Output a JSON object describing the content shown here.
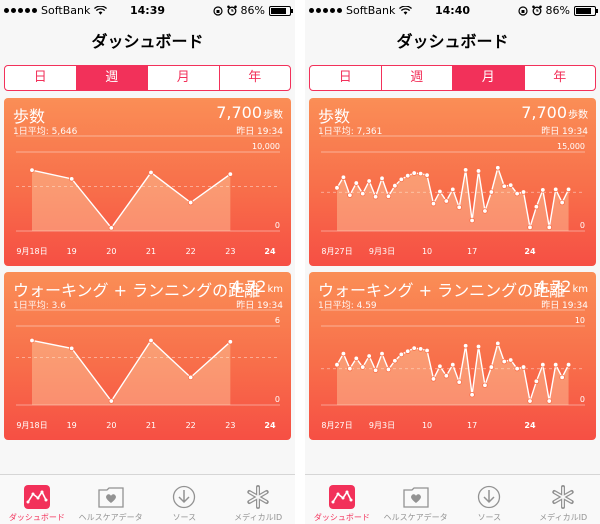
{
  "colors": {
    "accent": "#f2315a",
    "card_top": "#fa8e56",
    "card_bottom": "#f64f44",
    "tab_inactive": "#929292"
  },
  "icons": {
    "dashboard": "dashboard-chart-icon",
    "health_data": "heart-folder-icon",
    "sources": "download-arrow-icon",
    "medical_id": "medical-asterisk-icon"
  },
  "screens": [
    {
      "status": {
        "carrier": "SoftBank",
        "time": "14:39",
        "battery": "86%",
        "battery_level": 0.86
      },
      "title": "ダッシュボード",
      "segments": [
        {
          "label": "日",
          "active": false
        },
        {
          "label": "週",
          "active": true
        },
        {
          "label": "月",
          "active": false
        },
        {
          "label": "年",
          "active": false
        }
      ],
      "cards": [
        {
          "title": "歩数",
          "avg": "1日平均: 5,646",
          "value": "7,700",
          "unit": "歩数",
          "time": "昨日 19:34"
        },
        {
          "title": "ウォーキング + ランニングの距離",
          "avg": "1日平均: 3.6",
          "value": "4.72",
          "unit": "km",
          "time": "昨日 19:34"
        }
      ],
      "tabs": [
        {
          "label": "ダッシュボード",
          "active": true
        },
        {
          "label": "ヘルスケアデータ",
          "active": false
        },
        {
          "label": "ソース",
          "active": false
        },
        {
          "label": "メディカルID",
          "active": false
        }
      ]
    },
    {
      "status": {
        "carrier": "SoftBank",
        "time": "14:40",
        "battery": "86%",
        "battery_level": 0.86
      },
      "title": "ダッシュボード",
      "segments": [
        {
          "label": "日",
          "active": false
        },
        {
          "label": "週",
          "active": false
        },
        {
          "label": "月",
          "active": true
        },
        {
          "label": "年",
          "active": false
        }
      ],
      "cards": [
        {
          "title": "歩数",
          "avg": "1日平均: 7,361",
          "value": "7,700",
          "unit": "歩数",
          "time": "昨日 19:34"
        },
        {
          "title": "ウォーキング + ランニングの距離",
          "avg": "1日平均: 4.59",
          "value": "4.72",
          "unit": "km",
          "time": "昨日 19:34"
        }
      ],
      "tabs": [
        {
          "label": "ダッシュボード",
          "active": true
        },
        {
          "label": "ヘルスケアデータ",
          "active": false
        },
        {
          "label": "ソース",
          "active": false
        },
        {
          "label": "メディカルID",
          "active": false
        }
      ]
    }
  ],
  "chart_data": [
    {
      "type": "line",
      "screen": 0,
      "card": 0,
      "x_labels": [
        "9月18日",
        "19",
        "20",
        "21",
        "22",
        "23",
        "24"
      ],
      "y": [
        7700,
        6600,
        400,
        7400,
        3600,
        7200
      ],
      "ylim": [
        0,
        10000
      ],
      "y_tick_labels": [
        "10,000",
        "0"
      ],
      "avg": 5646
    },
    {
      "type": "line",
      "screen": 0,
      "card": 1,
      "x_labels": [
        "9月18日",
        "19",
        "20",
        "21",
        "22",
        "23",
        "24"
      ],
      "y": [
        4.9,
        4.3,
        0.3,
        4.9,
        2.1,
        4.8
      ],
      "ylim": [
        0,
        6
      ],
      "y_tick_labels": [
        "6",
        "0"
      ],
      "avg": 3.6
    },
    {
      "type": "line",
      "screen": 1,
      "card": 0,
      "x_labels": [
        "8月27日",
        "9月3日",
        "10",
        "17",
        "24"
      ],
      "y": [
        8200,
        10200,
        6800,
        9100,
        7100,
        9500,
        6500,
        10000,
        6600,
        8600,
        9800,
        10500,
        11000,
        10900,
        10600,
        5200,
        7500,
        5700,
        7900,
        4500,
        11600,
        2000,
        11400,
        3800,
        7400,
        12000,
        8500,
        8700,
        7100,
        7400,
        700,
        4600,
        7800,
        700,
        7900,
        5400,
        7900
      ],
      "ylim": [
        0,
        15000
      ],
      "y_tick_labels": [
        "15,000",
        "0"
      ],
      "avg": 7361
    },
    {
      "type": "line",
      "screen": 1,
      "card": 1,
      "x_labels": [
        "8月27日",
        "9月3日",
        "10",
        "17",
        "24"
      ],
      "y": [
        5.1,
        6.5,
        4.6,
        5.9,
        4.8,
        6.2,
        4.4,
        6.5,
        4.5,
        5.6,
        6.4,
        6.8,
        7.2,
        7.1,
        6.9,
        3.3,
        4.9,
        3.7,
        5.1,
        2.9,
        7.5,
        1.3,
        7.4,
        2.5,
        4.8,
        7.8,
        5.5,
        5.7,
        4.6,
        4.8,
        0.5,
        3.0,
        5.1,
        0.5,
        5.1,
        3.5,
        5.1
      ],
      "ylim": [
        0,
        10
      ],
      "y_tick_labels": [
        "10",
        "0"
      ],
      "avg": 4.59
    }
  ]
}
